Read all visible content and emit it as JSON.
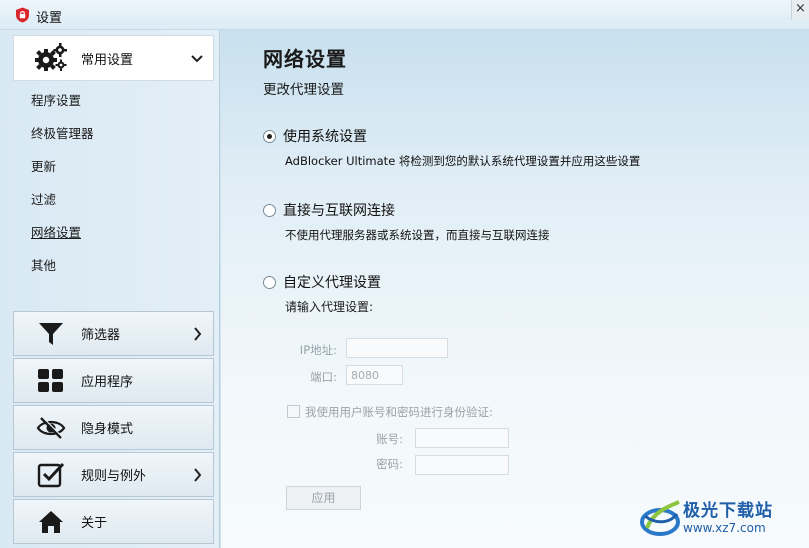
{
  "window": {
    "title": "设置",
    "close_label": "×"
  },
  "sidebar": {
    "general": {
      "label": "常用设置",
      "icon": "gears-icon"
    },
    "sub_items": [
      {
        "label": "程序设置"
      },
      {
        "label": "终极管理器"
      },
      {
        "label": "更新"
      },
      {
        "label": "过滤"
      },
      {
        "label": "网络设置",
        "current": true
      },
      {
        "label": "其他"
      }
    ],
    "buttons": [
      {
        "label": "筛选器",
        "icon": "filter-icon",
        "has_arrow": true
      },
      {
        "label": "应用程序",
        "icon": "apps-grid-icon",
        "has_arrow": false
      },
      {
        "label": "隐身模式",
        "icon": "hidden-eye-icon",
        "has_arrow": false
      },
      {
        "label": "规则与例外",
        "icon": "checkbox-check-icon",
        "has_arrow": true
      },
      {
        "label": "关于",
        "icon": "home-icon",
        "has_arrow": false
      }
    ]
  },
  "main": {
    "title": "网络设置",
    "subtitle": "更改代理设置",
    "options": [
      {
        "label": "使用系统设置",
        "description": "AdBlocker Ultimate 将检测到您的默认系统代理设置并应用这些设置",
        "checked": true
      },
      {
        "label": "直接与互联网连接",
        "description": "不使用代理服务器或系统设置，而直接与互联网连接",
        "checked": false
      },
      {
        "label": "自定义代理设置",
        "description": "",
        "checked": false
      }
    ],
    "custom": {
      "prompt": "请输入代理设置:",
      "ip_label": "IP地址:",
      "ip_value": "",
      "port_label": "端口:",
      "port_value": "8080",
      "auth_label": "我使用用户账号和密码进行身份验证:",
      "account_label": "账号:",
      "account_value": "",
      "password_label": "密码:",
      "password_value": "",
      "apply_label": "应用"
    }
  },
  "watermark": {
    "line1": "极光下载站",
    "line2": "www.xz7.com"
  },
  "colors": {
    "accent_red": "#d9252b",
    "watermark_blue": "#1f5ea8"
  }
}
